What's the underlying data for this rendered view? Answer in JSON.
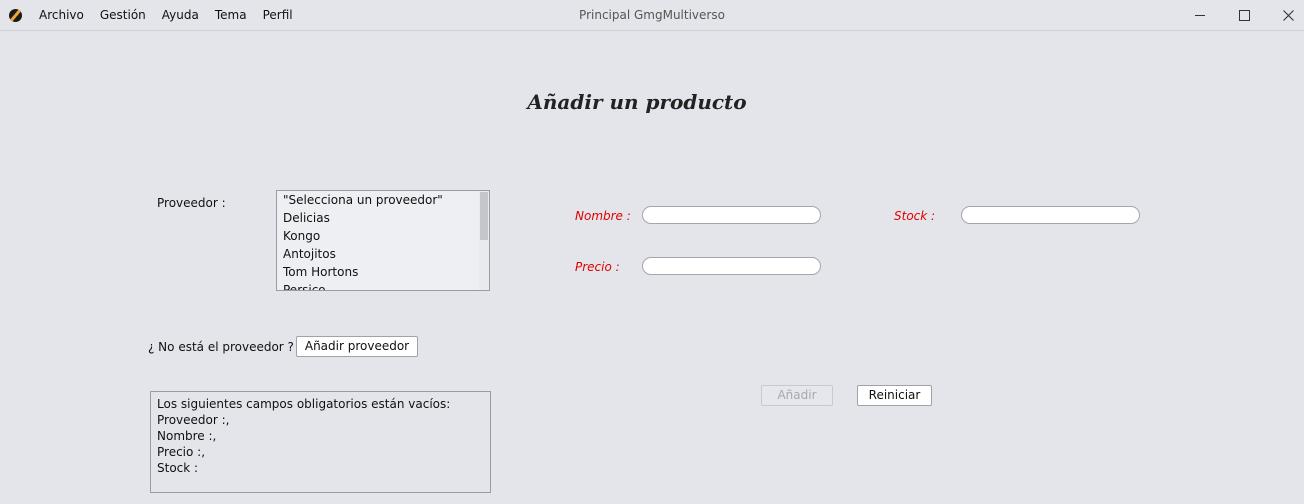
{
  "window": {
    "title": "Principal GmgMultiverso",
    "menu": [
      "Archivo",
      "Gestión",
      "Ayuda",
      "Tema",
      "Perfil"
    ],
    "controls": {
      "minimize": "minimize-icon",
      "maximize": "maximize-icon",
      "close": "close-icon"
    }
  },
  "form": {
    "heading": "Añadir un producto",
    "proveedor_label": "Proveedor  :",
    "proveedores": [
      "\"Selecciona un proveedor\"",
      "Delicias",
      "Kongo",
      "Antojitos",
      "Tom Hortons",
      "Persico"
    ],
    "no_proveedor_label": "¿ No está el proveedor ? :",
    "add_proveedor_button": "Añadir proveedor",
    "nombre_label": "Nombre :",
    "precio_label": "Precio :",
    "stock_label": "Stock :",
    "nombre_value": "",
    "precio_value": "",
    "stock_value": "",
    "add_button": "Añadir",
    "reset_button": "Reiniciar",
    "validation_messages": [
      "Los siguientes campos obligatorios están vacíos:",
      "Proveedor  :,",
      "Nombre :,",
      "Precio :,",
      "Stock :"
    ]
  },
  "colors": {
    "required_label": "#e00000",
    "background": "#e4e5ea"
  }
}
